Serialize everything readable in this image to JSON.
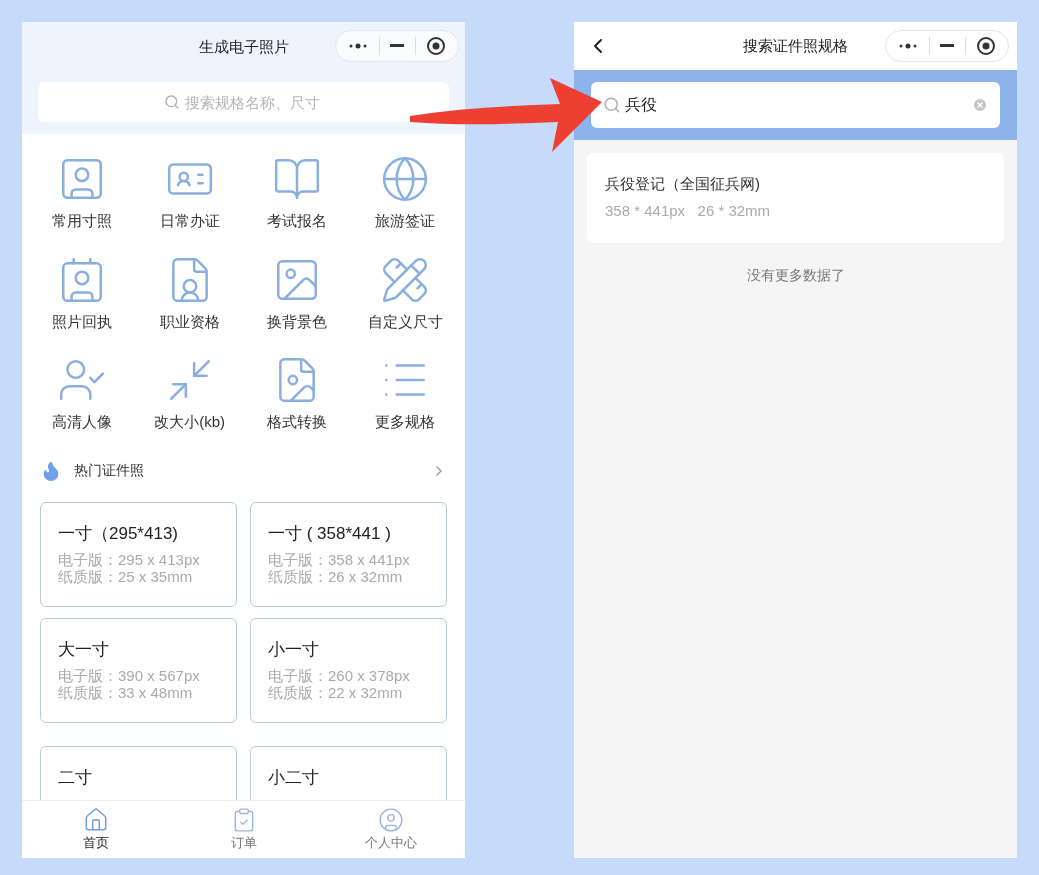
{
  "left_screen": {
    "title": "生成电子照片",
    "search": {
      "placeholder": "搜索规格名称、尺寸"
    },
    "categories": [
      {
        "label": "常用寸照",
        "kind": "portrait"
      },
      {
        "label": "日常办证",
        "kind": "idcard"
      },
      {
        "label": "考试报名",
        "kind": "book"
      },
      {
        "label": "旅游签证",
        "kind": "passport"
      },
      {
        "label": "照片回执",
        "kind": "receipt"
      },
      {
        "label": "职业资格",
        "kind": "certificate"
      },
      {
        "label": "换背景色",
        "kind": "image"
      },
      {
        "label": "自定义尺寸",
        "kind": "tools"
      },
      {
        "label": "高清人像",
        "kind": "usercheck"
      },
      {
        "label": "改大小(kb)",
        "kind": "resize"
      },
      {
        "label": "格式转换",
        "kind": "file"
      },
      {
        "label": "更多规格",
        "kind": "list"
      }
    ],
    "hot_section": {
      "title": "热门证件照"
    },
    "cards": [
      {
        "title": "一寸（295*413)",
        "electronic": "电子版：295 x 413px",
        "paper": "纸质版：25 x 35mm"
      },
      {
        "title": "一寸 ( 358*441 )",
        "electronic": "电子版：358 x 441px",
        "paper": "纸质版：26 x 32mm"
      },
      {
        "title": "大一寸",
        "electronic": "电子版：390 x 567px",
        "paper": "纸质版：33 x 48mm"
      },
      {
        "title": "小一寸",
        "electronic": "电子版：260 x 378px",
        "paper": "纸质版：22 x 32mm"
      },
      {
        "title": "二寸"
      },
      {
        "title": "小二寸"
      }
    ],
    "tab_bar": [
      {
        "label": "首页",
        "kind": "home",
        "selected": true
      },
      {
        "label": "订单",
        "kind": "orders",
        "selected": false
      },
      {
        "label": "个人中心",
        "kind": "profile",
        "selected": false
      }
    ]
  },
  "right_screen": {
    "title": "搜索证件照规格",
    "search": {
      "value": "兵役"
    },
    "results": [
      {
        "name": "兵役登记（全国征兵网)",
        "size": "358 * 441px   26 * 32mm"
      }
    ],
    "end_message": "没有更多数据了"
  }
}
